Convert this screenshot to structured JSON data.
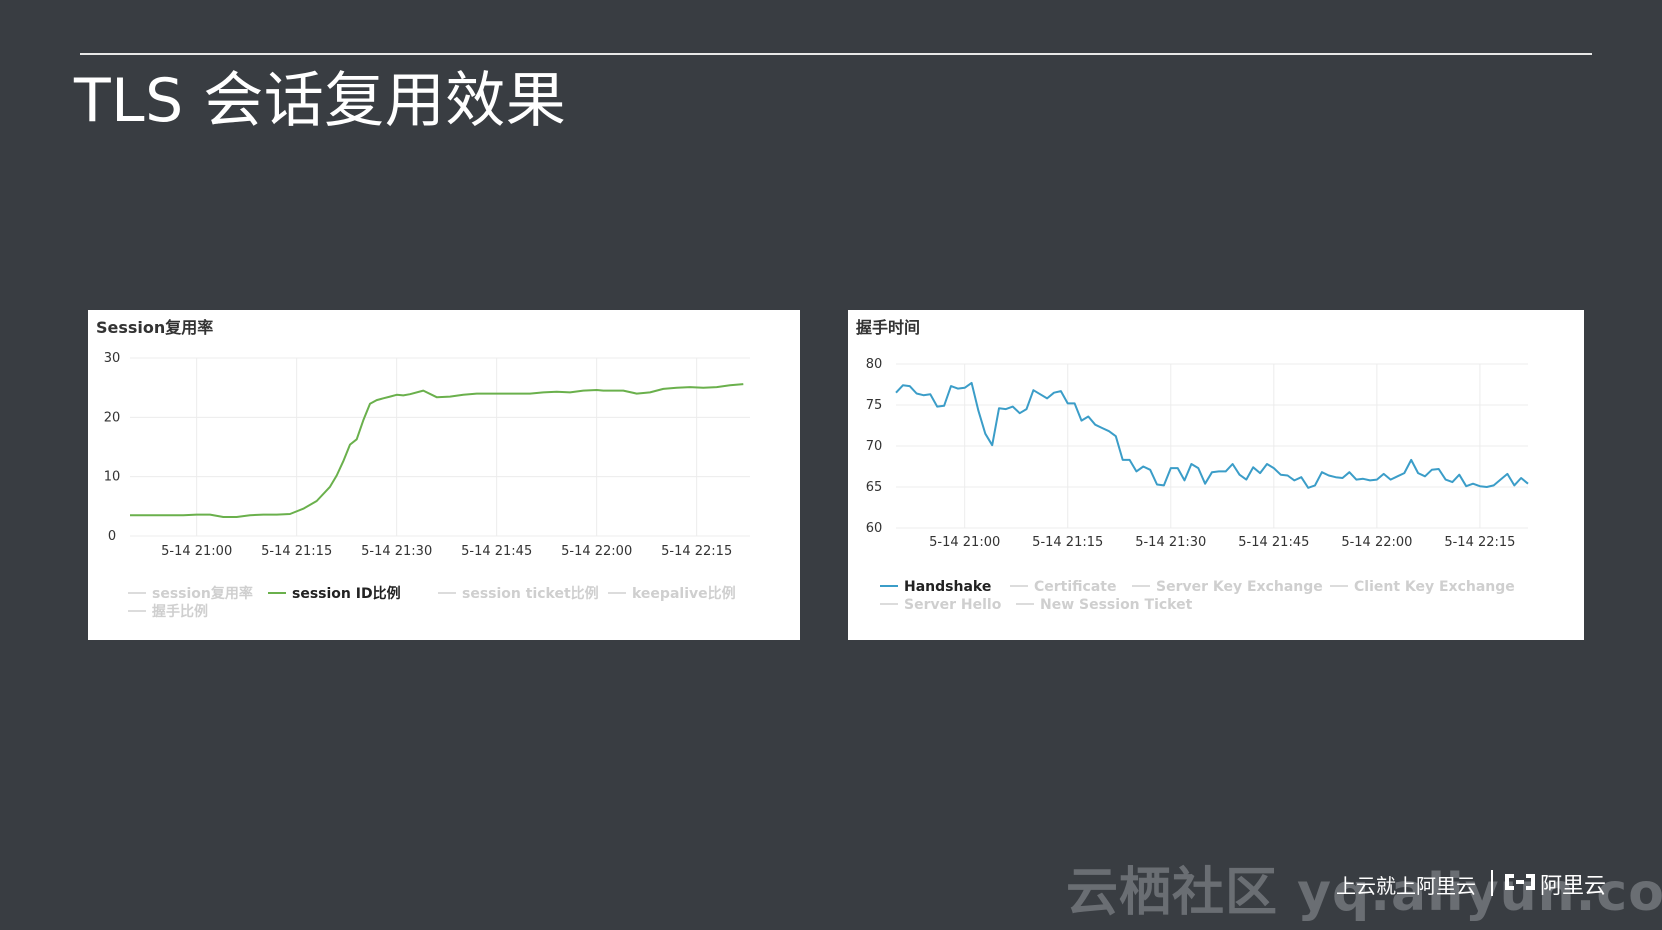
{
  "slide": {
    "title": "TLS 会话复用效果"
  },
  "footer": {
    "watermark": "云栖社区 yq.aliyun.com",
    "slogan": "上云就上阿里云",
    "logo_text": "阿里云",
    "logo_icon": "aliyun-logo-icon"
  },
  "chart_data": [
    {
      "type": "line",
      "title": "Session复用率",
      "xlabel": "",
      "ylabel": "",
      "ylim": [
        0,
        30
      ],
      "yticks": [
        "0",
        "10",
        "20",
        "30"
      ],
      "xticks": [
        "5-14 21:00",
        "5-14 21:15",
        "5-14 21:30",
        "5-14 21:45",
        "5-14 22:00",
        "5-14 22:15"
      ],
      "xlim": [
        -10,
        83
      ],
      "grid": true,
      "legend_position": "bottom",
      "legend": [
        {
          "name": "session复用率",
          "color": "#d8d8d8",
          "active": false
        },
        {
          "name": "session ID比例",
          "color": "#6ab04c",
          "active": true
        },
        {
          "name": "session ticket比例",
          "color": "#d8d8d8",
          "active": false
        },
        {
          "name": "keepalive比例",
          "color": "#d8d8d8",
          "active": false
        },
        {
          "name": "握手比例",
          "color": "#d8d8d8",
          "active": false
        }
      ],
      "series": [
        {
          "name": "session ID比例",
          "color": "#6ab04c",
          "x": [
            -10,
            -8,
            -6,
            -4,
            -2,
            0,
            2,
            4,
            6,
            8,
            10,
            12,
            14,
            16,
            18,
            20,
            21,
            22,
            23,
            24,
            25,
            26,
            27,
            28,
            29,
            30,
            31,
            32,
            34,
            36,
            38,
            40,
            42,
            44,
            46,
            48,
            50,
            52,
            54,
            56,
            58,
            60,
            61,
            62,
            63,
            64,
            66,
            68,
            70,
            72,
            74,
            76,
            78,
            80,
            82
          ],
          "values": [
            3.5,
            3.5,
            3.5,
            3.5,
            3.5,
            3.6,
            3.6,
            3.2,
            3.2,
            3.5,
            3.6,
            3.6,
            3.7,
            4.6,
            5.9,
            8.3,
            10.2,
            12.6,
            15.4,
            16.3,
            19.5,
            22.3,
            22.9,
            23.2,
            23.5,
            23.8,
            23.7,
            23.9,
            24.5,
            23.4,
            23.5,
            23.8,
            24.0,
            24.0,
            24.0,
            24.0,
            24.0,
            24.2,
            24.3,
            24.2,
            24.5,
            24.6,
            24.5,
            24.5,
            24.5,
            24.5,
            24.0,
            24.2,
            24.8,
            25.0,
            25.1,
            25.0,
            25.1,
            25.4,
            25.6
          ]
        }
      ]
    },
    {
      "type": "line",
      "title": "握手时间",
      "xlabel": "",
      "ylabel": "",
      "ylim": [
        60,
        80
      ],
      "yticks": [
        "60",
        "65",
        "70",
        "75",
        "80"
      ],
      "xticks": [
        "5-14 21:00",
        "5-14 21:15",
        "5-14 21:30",
        "5-14 21:45",
        "5-14 22:00",
        "5-14 22:15"
      ],
      "xlim": [
        -10,
        82
      ],
      "grid": true,
      "legend_position": "bottom",
      "legend": [
        {
          "name": "Handshake",
          "color": "#3b9dc8",
          "active": true
        },
        {
          "name": "Certificate",
          "color": "#d8d8d8",
          "active": false
        },
        {
          "name": "Server Key Exchange",
          "color": "#d8d8d8",
          "active": false
        },
        {
          "name": "Client Key Exchange",
          "color": "#d8d8d8",
          "active": false
        },
        {
          "name": "Server Hello",
          "color": "#d8d8d8",
          "active": false
        },
        {
          "name": "New Session Ticket",
          "color": "#d8d8d8",
          "active": false
        }
      ],
      "series": [
        {
          "name": "Handshake",
          "color": "#3b9dc8",
          "x": [
            -10,
            -9,
            -8,
            -7,
            -6,
            -5,
            -4,
            -3,
            -2,
            -1,
            0,
            1,
            2,
            3,
            4,
            5,
            6,
            7,
            8,
            9,
            10,
            11,
            12,
            13,
            14,
            15,
            16,
            17,
            18,
            19,
            20,
            21,
            22,
            23,
            24,
            25,
            26,
            27,
            28,
            29,
            30,
            31,
            32,
            33,
            34,
            35,
            36,
            37,
            38,
            39,
            40,
            41,
            42,
            43,
            44,
            45,
            46,
            47,
            48,
            49,
            50,
            51,
            52,
            53,
            54,
            55,
            56,
            57,
            58,
            59,
            60,
            61,
            62,
            63,
            64,
            65,
            66,
            67,
            68,
            69,
            70,
            71,
            72,
            73,
            74,
            75,
            76,
            77,
            78,
            79,
            80,
            81,
            82
          ],
          "values": [
            76.5,
            77.4,
            77.3,
            76.4,
            76.2,
            76.3,
            74.8,
            74.9,
            77.3,
            77.0,
            77.1,
            77.7,
            74.3,
            71.5,
            70.1,
            74.6,
            74.5,
            74.8,
            74.0,
            74.5,
            76.8,
            76.3,
            75.8,
            76.5,
            76.7,
            75.2,
            75.2,
            73.1,
            73.6,
            72.6,
            72.2,
            71.8,
            71.2,
            68.3,
            68.3,
            66.9,
            67.5,
            67.1,
            65.3,
            65.2,
            67.3,
            67.3,
            65.8,
            67.8,
            67.3,
            65.4,
            66.8,
            66.9,
            66.9,
            67.8,
            66.5,
            65.9,
            67.4,
            66.7,
            67.8,
            67.3,
            66.5,
            66.4,
            65.8,
            66.2,
            64.9,
            65.2,
            66.8,
            66.4,
            66.2,
            66.1,
            66.8,
            65.9,
            66.0,
            65.8,
            65.9,
            66.6,
            65.9,
            66.3,
            66.7,
            68.3,
            66.7,
            66.3,
            67.1,
            67.2,
            65.9,
            65.6,
            66.5,
            65.1,
            65.4,
            65.1,
            65.0,
            65.2,
            65.9,
            66.6,
            65.2,
            66.1,
            65.4
          ]
        }
      ]
    }
  ]
}
